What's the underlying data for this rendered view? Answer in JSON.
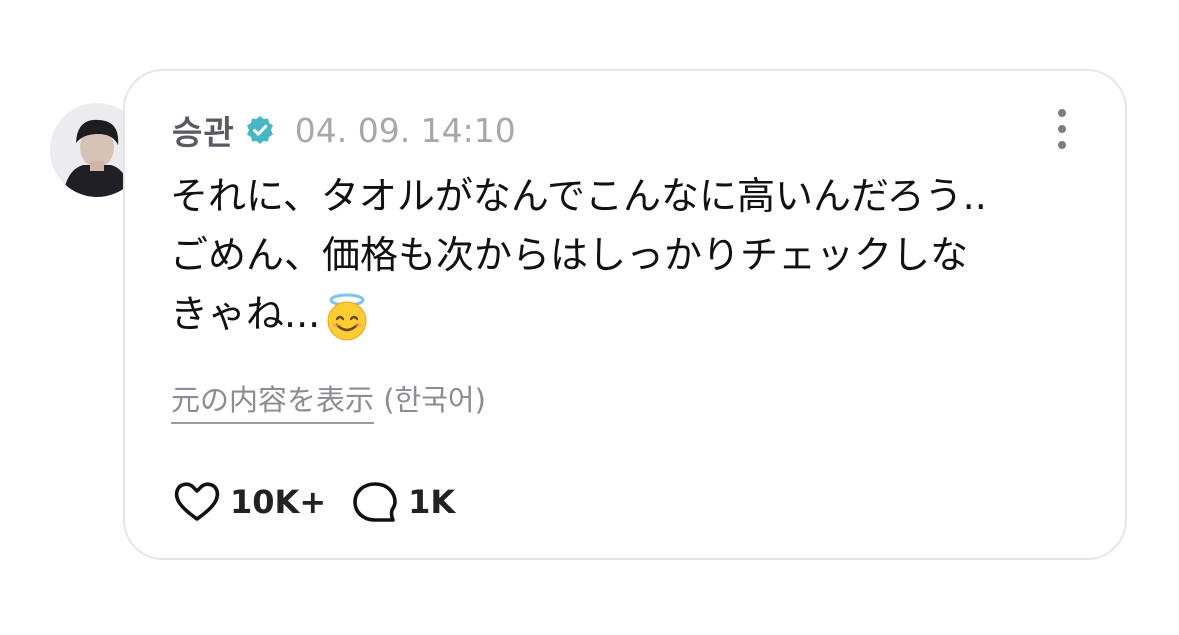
{
  "post": {
    "username": "승관",
    "verified_icon": "verified-badge-icon",
    "timestamp": "04. 09. 14:10",
    "text_line1": "それに、タオルがなんでこんなに高いんだろう..",
    "text_line2": "ごめん、価格も次からはしっかりチェックしな",
    "text_line3": "きゃね...",
    "emoji": "smiling-face-with-halo",
    "translate_link": "元の内容を表示",
    "translate_lang": " (한국어)",
    "likes": "10K+",
    "comments": "1K"
  },
  "colors": {
    "verified": "#48b7c4",
    "border": "#e6e6e9",
    "muted": "#a7a7ac"
  }
}
